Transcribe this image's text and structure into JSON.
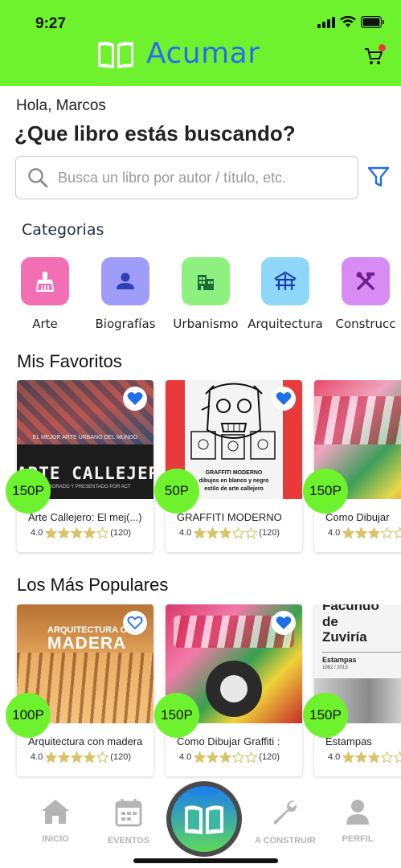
{
  "status": {
    "time": "9:27"
  },
  "brand": {
    "name": "Acumar"
  },
  "greeting": "Hola, Marcos",
  "headline": "¿Que libro estás buscando?",
  "search": {
    "placeholder": "Busca un libro por autor / título, etc.",
    "value": ""
  },
  "categories": {
    "title": "Categorias",
    "items": [
      {
        "label": "Arte",
        "icon": "brush-icon",
        "color": "#f26fb4"
      },
      {
        "label": "Biografías",
        "icon": "person-icon",
        "color": "#9f9df8"
      },
      {
        "label": "Urbanismo",
        "icon": "building-icon",
        "color": "#8ef07e"
      },
      {
        "label": "Arquitectura",
        "icon": "structure-icon",
        "color": "#8fd7f9"
      },
      {
        "label": "Construcc",
        "icon": "tools-icon",
        "color": "#d88bf3"
      }
    ]
  },
  "favorites": {
    "title": "Mis Favoritos",
    "books": [
      {
        "title": "Arte Callejero: El mej(...)",
        "price": "150P",
        "rating": "4.0",
        "reviews": "(120)",
        "stars": 4
      },
      {
        "title": "GRAFFITI MODERNO",
        "price": "50P",
        "rating": "4.0",
        "reviews": "(120)",
        "stars": 3
      },
      {
        "title": "Como Dibujar",
        "price": "150P",
        "rating": "4.0",
        "reviews": "",
        "stars": 3
      }
    ]
  },
  "popular": {
    "title": "Los Más Populares",
    "books": [
      {
        "title": "Arquitectura con madera",
        "price": "100P",
        "rating": "4.0",
        "reviews": "(120)",
        "stars": 4
      },
      {
        "title": "Como Dibujar Graffiti :",
        "price": "150P",
        "rating": "4.0",
        "reviews": "(120)",
        "stars": 3
      },
      {
        "title": "Estampas",
        "price": "150P",
        "rating": "4.0",
        "reviews": "",
        "stars": 3
      }
    ]
  },
  "covers": {
    "arte": {
      "line1": "EL MEJOR ARTE URBANO DEL MUNDO",
      "line2": "ARTE CALLEJERO",
      "line3": "ELABORADO Y PRESENTADO POR ACT"
    },
    "graffiti": {
      "line1": "GRAFFITI MODERNO",
      "line2": "dibujos en blanco y negro",
      "line3": "estilo de arte callejero"
    },
    "madera": {
      "line1": "ARQUITECTURA C",
      "line2": "MADERA"
    },
    "estampas": {
      "line1": "Facundo",
      "line2": "de",
      "line3": "Zuviría",
      "line4": "Estampas",
      "line5": "1982 / 2013"
    }
  },
  "nav": {
    "items": [
      {
        "label": "INICIO"
      },
      {
        "label": "EVENTOS"
      },
      {
        "label": "A CONSTRUIR"
      },
      {
        "label": "PERFIL"
      }
    ]
  },
  "colors": {
    "header": "#6ff22e",
    "brand": "#2a6cf0",
    "price_badge": "#6ff22e",
    "star": "#d7c46a",
    "heart": "#1f6fe8"
  }
}
